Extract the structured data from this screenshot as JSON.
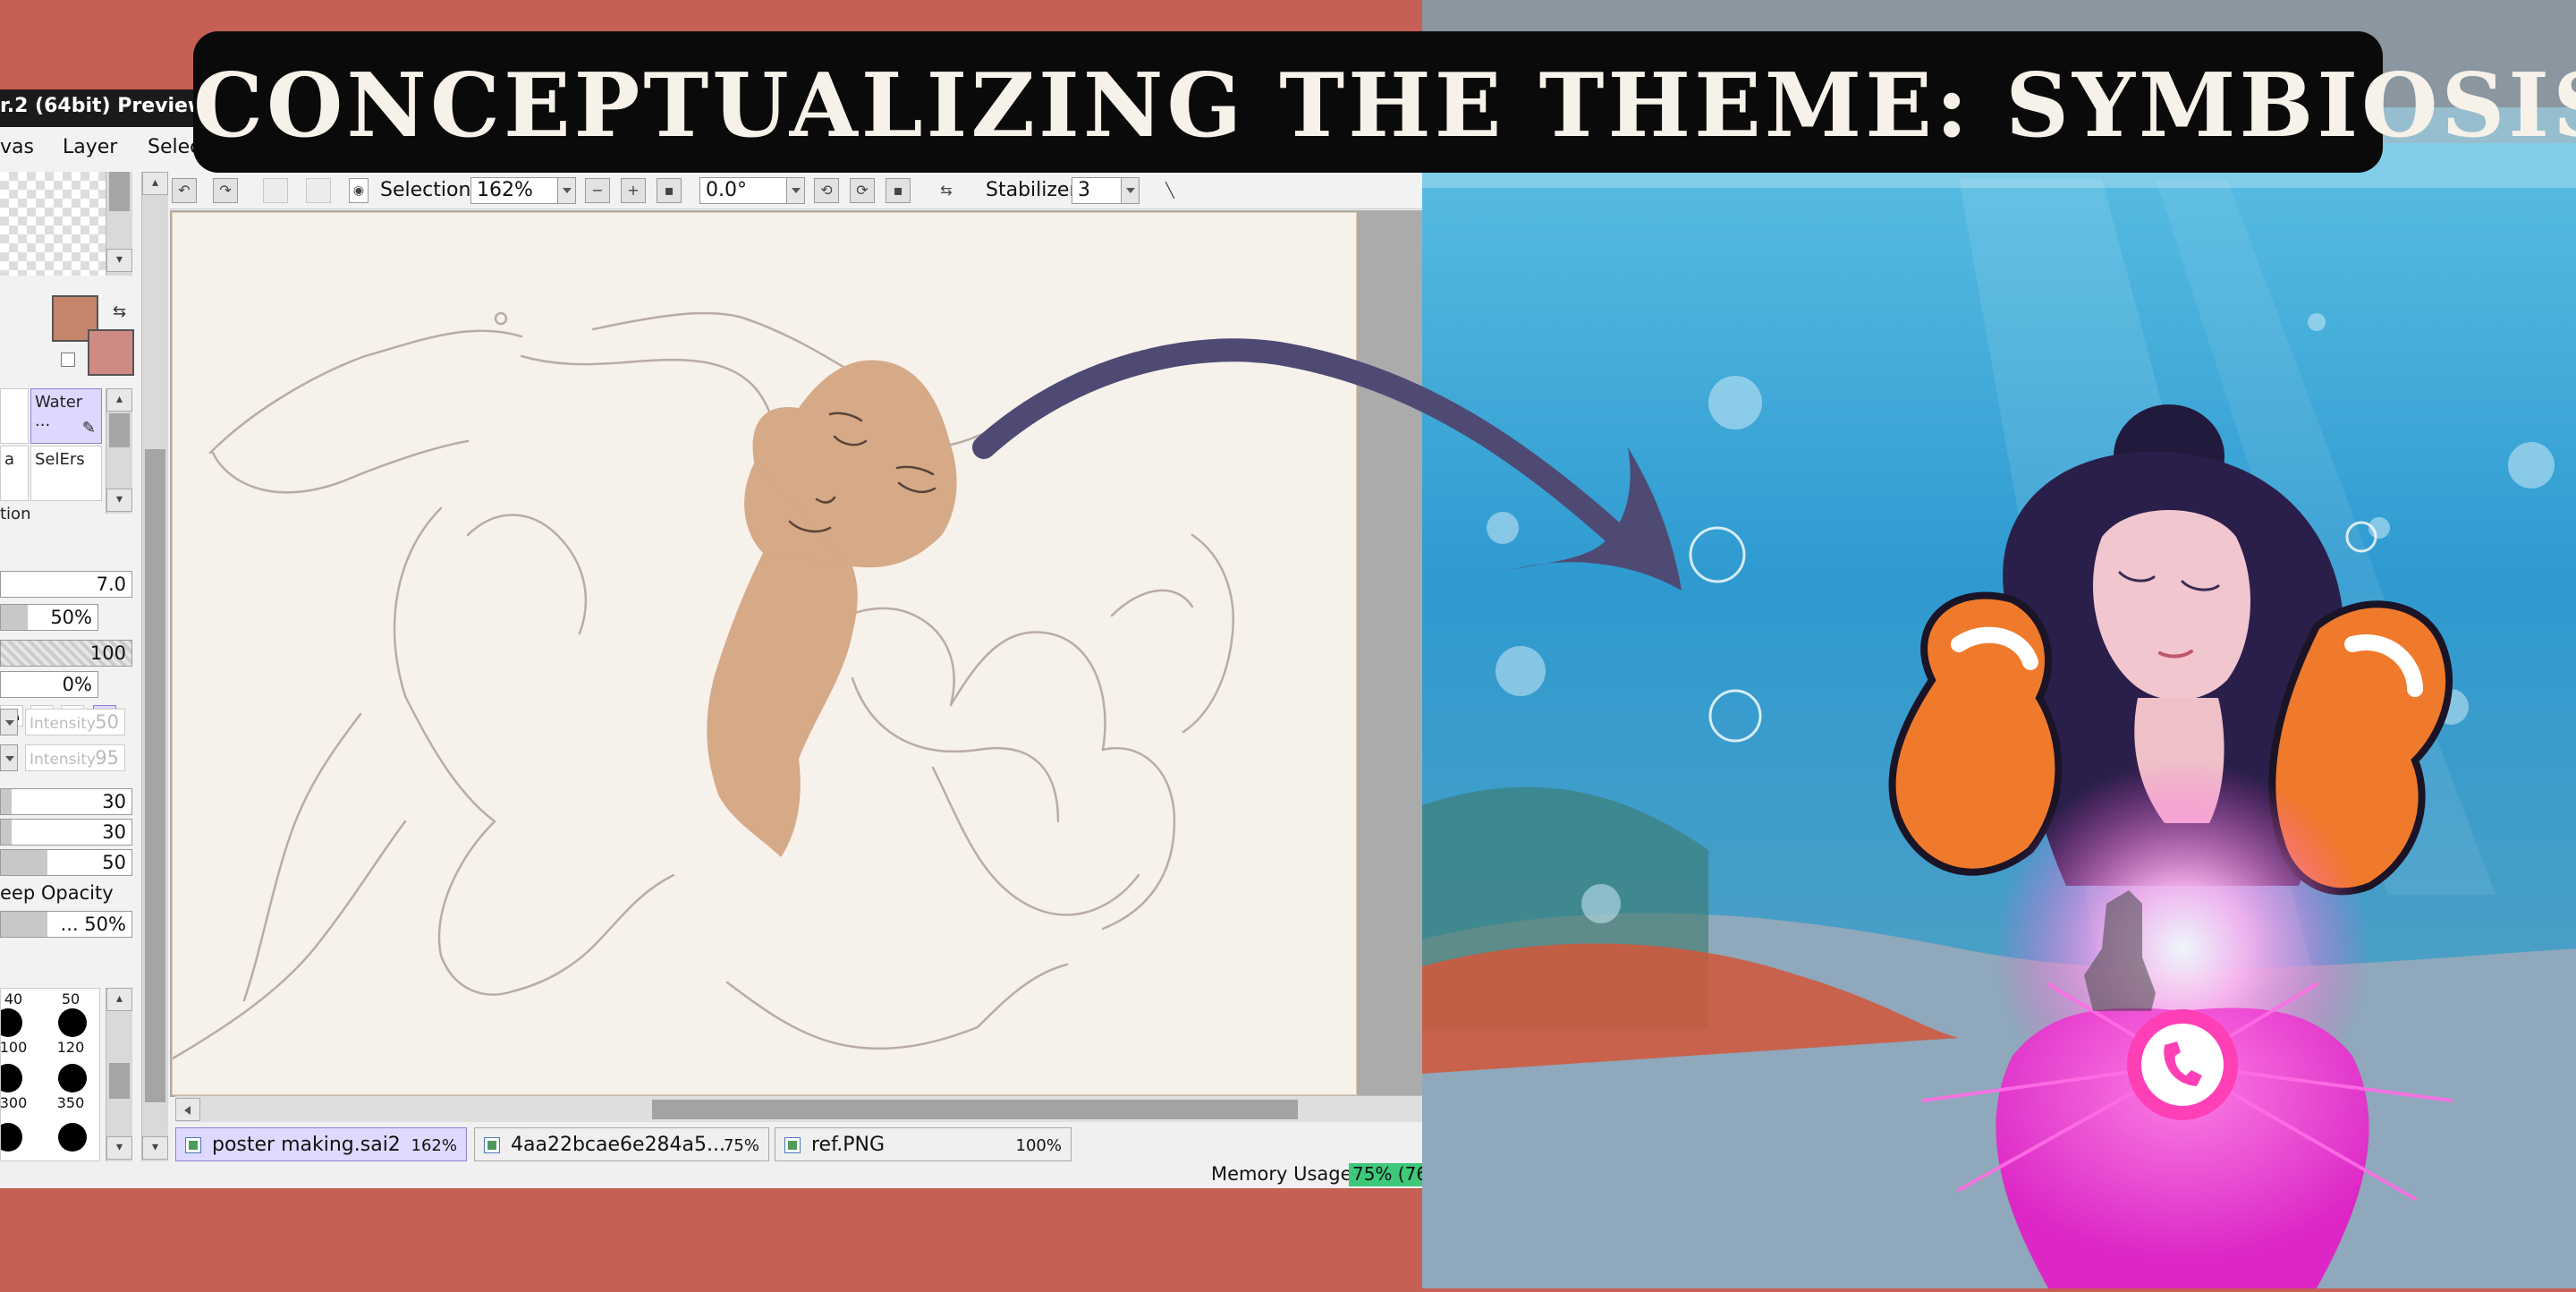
{
  "headline": "CONCEPTUALIZING THE THEME: SYMBIOSIS",
  "app": {
    "title": "r.2 (64bit) Preview...",
    "menu": [
      "vas",
      "Layer",
      "Selec"
    ]
  },
  "toolbar": {
    "selection_label": "Selection",
    "zoom": "162%",
    "angle": "0.0°",
    "stabilizer_label": "Stabilizer",
    "stabilizer_value": "3"
  },
  "tools": {
    "water_label": "Water ...",
    "selers_label": "SelErs",
    "a_label": "a",
    "tion_label": "tion"
  },
  "brush": {
    "size": "7.0",
    "density": "50%",
    "texture": "100",
    "blend": "0%",
    "intensity1_label": "Intensity",
    "intensity1_value": "50",
    "intensity2_label": "Intensity",
    "intensity2_value": "95",
    "v1": "30",
    "v2": "30",
    "v3": "50",
    "keep_opacity_label": "eep Opacity",
    "keep_opacity_value": "... 50%",
    "sizes": [
      "40",
      "50",
      "100",
      "120",
      "300",
      "350"
    ]
  },
  "file_tabs": [
    {
      "name": "poster making.sai2",
      "percent": "162%"
    },
    {
      "name": "4aa22bcae6e284a5...",
      "percent": "75%"
    },
    {
      "name": "ref.PNG",
      "percent": "100%"
    }
  ],
  "status": {
    "memory_label": "Memory Usage",
    "memory_value": "75% (76"
  },
  "colors": {
    "main_color": "#c4856a",
    "sub_color": "#cf8a84",
    "background": "#c65f54",
    "arrow": "#4e4a73"
  }
}
